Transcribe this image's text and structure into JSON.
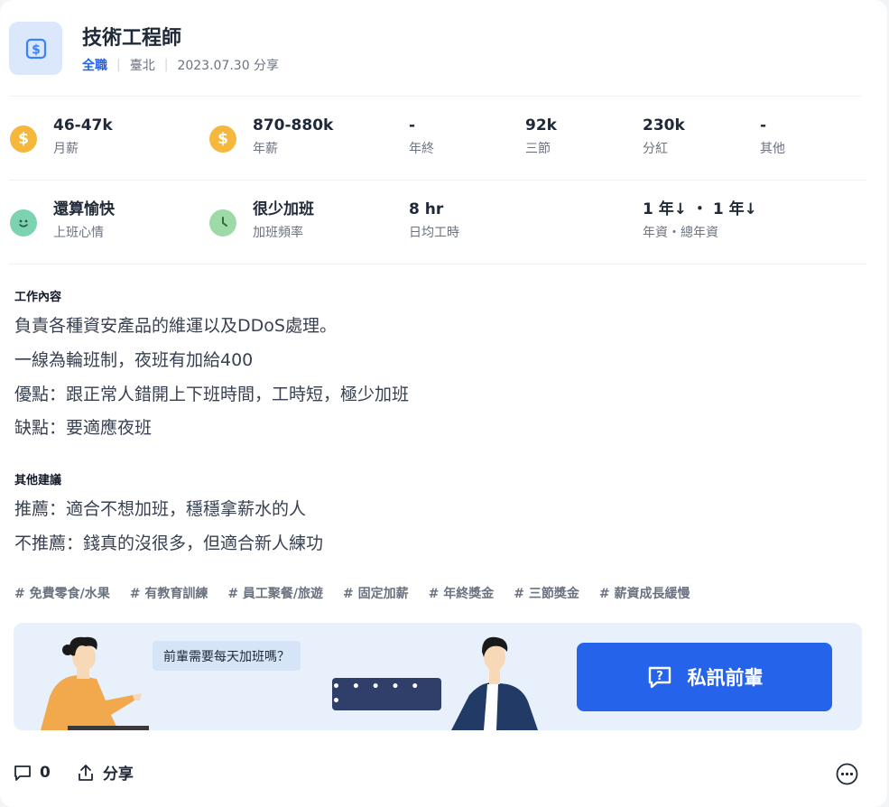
{
  "job": {
    "title": "技術工程師",
    "employment_type": "全職",
    "location": "臺北",
    "date_shared": "2023.07.30 分享"
  },
  "salary": [
    {
      "value": "46-47k",
      "label": "月薪"
    },
    {
      "value": "870-880k",
      "label": "年薪"
    },
    {
      "value": "-",
      "label": "年終"
    },
    {
      "value": "92k",
      "label": "三節"
    },
    {
      "value": "230k",
      "label": "分紅"
    },
    {
      "value": "-",
      "label": "其他"
    }
  ],
  "work": [
    {
      "value": "還算愉快",
      "label": "上班心情"
    },
    {
      "value": "很少加班",
      "label": "加班頻率"
    },
    {
      "value": "8 hr",
      "label": "日均工時"
    },
    {
      "value": "1 年↓ ・ 1 年↓",
      "label": "年資・總年資"
    }
  ],
  "content": {
    "title": "工作內容",
    "lines": [
      "負責各種資安產品的維運以及DDoS處理。",
      "一線為輪班制，夜班有加給400",
      "優點：跟正常人錯開上下班時間，工時短，極少加班",
      "缺點：要適應夜班"
    ]
  },
  "suggestion": {
    "title": "其他建議",
    "lines": [
      "推薦：適合不想加班，穩穩拿薪水的人",
      "不推薦：錢真的沒很多，但適合新人練功"
    ]
  },
  "tags": [
    "# 免費零食/水果",
    "# 有教育訓練",
    "# 員工聚餐/旅遊",
    "# 固定加薪",
    "# 年終獎金",
    "# 三節獎金",
    "# 薪資成長緩慢"
  ],
  "banner": {
    "question": "前輩需要每天加班嗎？",
    "dots": "• • • • • •",
    "button_label": "私訊前輩"
  },
  "footer": {
    "comment_count": "0",
    "share_label": "分享"
  },
  "colors": {
    "accent": "#2563eb",
    "money_icon": "#f5b83d",
    "mood_icon": "#7dd3b0",
    "clock_icon": "#9ed9a8",
    "banner_bg": "#e7f0fb"
  }
}
